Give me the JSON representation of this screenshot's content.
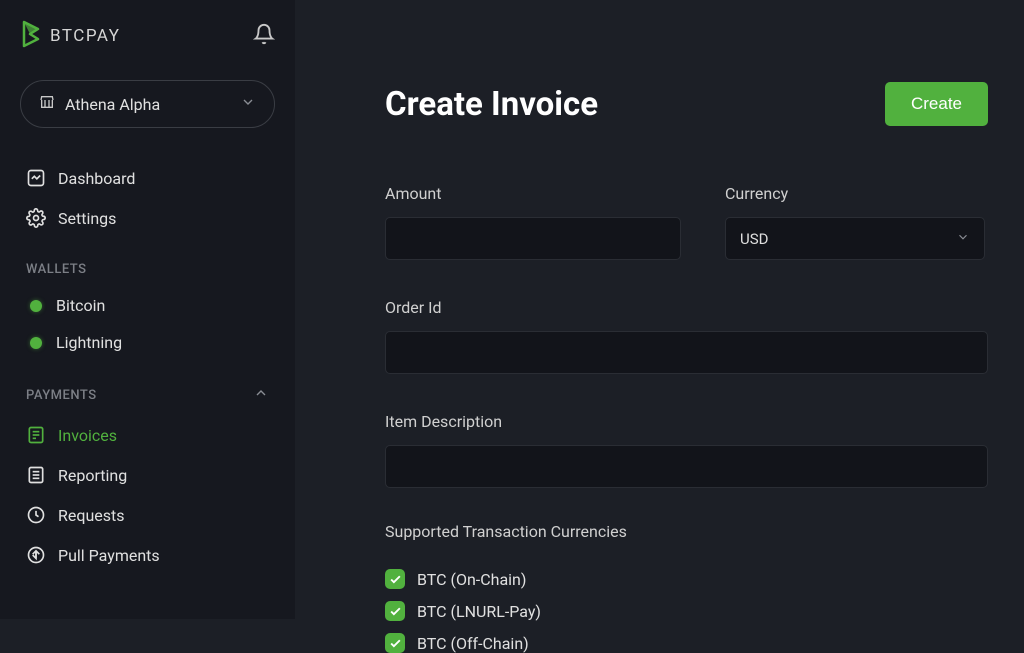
{
  "brand": "BTCPAY",
  "store_selector": {
    "name": "Athena Alpha"
  },
  "sidebar": {
    "dashboard": "Dashboard",
    "settings": "Settings",
    "wallets_header": "WALLETS",
    "wallets": [
      {
        "label": "Bitcoin"
      },
      {
        "label": "Lightning"
      }
    ],
    "payments_header": "PAYMENTS",
    "payments": [
      {
        "label": "Invoices",
        "active": true
      },
      {
        "label": "Reporting"
      },
      {
        "label": "Requests"
      },
      {
        "label": "Pull Payments"
      }
    ]
  },
  "page": {
    "title": "Create Invoice",
    "create_btn": "Create",
    "fields": {
      "amount_label": "Amount",
      "currency_label": "Currency",
      "currency_value": "USD",
      "order_id_label": "Order Id",
      "item_desc_label": "Item Description",
      "supported_label": "Supported Transaction Currencies",
      "currencies": [
        {
          "label": "BTC (On-Chain)"
        },
        {
          "label": "BTC (LNURL-Pay)"
        },
        {
          "label": "BTC (Off-Chain)"
        }
      ]
    }
  }
}
